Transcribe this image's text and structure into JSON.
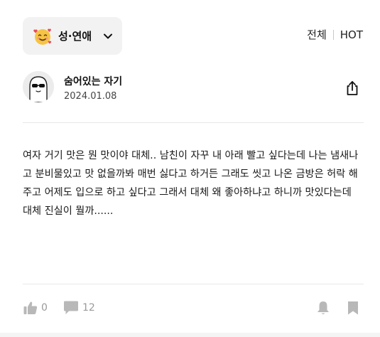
{
  "category": {
    "label": "성·연애",
    "icon": "smiling-face-with-hearts-icon"
  },
  "sort_tabs": [
    "전체",
    "HOT"
  ],
  "post": {
    "author": "숨어있는 자기",
    "date": "2024.01.08",
    "body": "여자 거기 맛은 뭔 맛이야 대체.. 남친이 자꾸 내 아래 빨고 싶다는데 나는 냄새나고 분비물있고 맛 없을까봐 매번 싫다고 하거든 그래도 씻고 나온 금방은 허락 해주고 어제도 입으로 하고 싶다고 그래서 대체 왜 좋아하냐고 하니까 맛있다는데 대체 진실이 뭘까......"
  },
  "stats": {
    "likes": "0",
    "comments": "12"
  },
  "icons": {
    "share": "share-icon",
    "like": "thumbs-up-icon",
    "comment": "comment-icon",
    "alarm": "bell-icon",
    "bookmark": "bookmark-icon"
  },
  "colors": {
    "icon_gray": "#b8b8b8",
    "count_gray": "#9a9a9a",
    "chip_bg": "#f2f2f2"
  }
}
